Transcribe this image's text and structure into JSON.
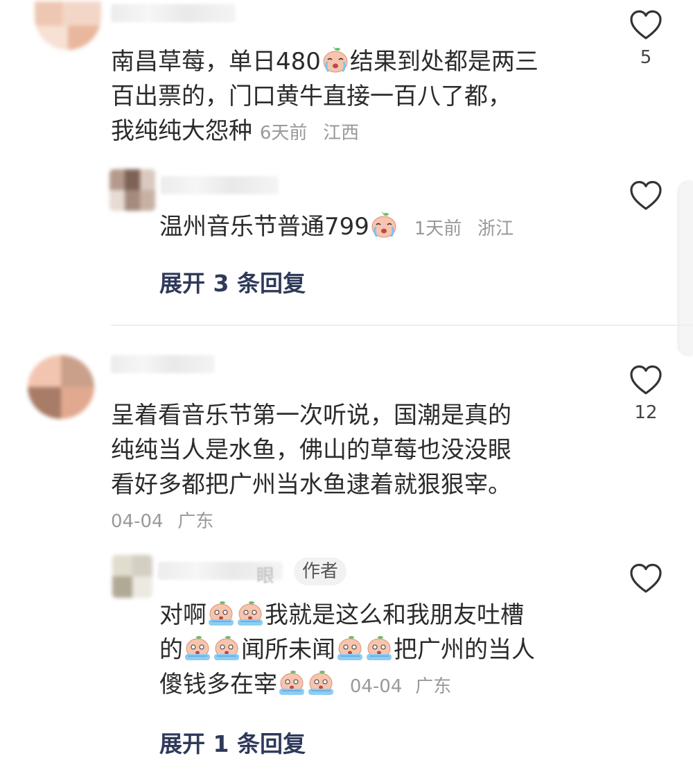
{
  "comments": [
    {
      "text_parts": [
        "南昌草莓，单日480",
        "结果到处都是两三",
        "百出票的，门口黄牛直接一百八了都，",
        "我纯纯大怨种"
      ],
      "time": "6天前",
      "location": "江西",
      "likes": "5",
      "reply": {
        "text": "温州音乐节普通799",
        "time": "1天前",
        "location": "浙江"
      },
      "expand_label": "展开 3 条回复"
    },
    {
      "text_lines": [
        "呈着看音乐节第一次听说，国潮是真的",
        "纯纯当人是水鱼，佛山的草莓也没没眼",
        "看好多都把广州当水鱼逮着就狠狠宰。"
      ],
      "date": "04-04",
      "location": "广东",
      "likes": "12",
      "reply": {
        "author_tag": "作者",
        "name_fragment": "眼",
        "parts": [
          "对啊",
          "我就是这么和我朋友吐槽",
          "的",
          "闻所未闻",
          "把广州的当人",
          "傻钱多在宰"
        ],
        "date": "04-04",
        "location": "广东"
      },
      "expand_label": "展开 1 条回复"
    }
  ],
  "icons": {
    "like": "heart-outline-icon",
    "emoji": "crying-peach-emoji-icon"
  },
  "colors": {
    "expand_link": "#2f3a5a",
    "meta": "#999999"
  }
}
